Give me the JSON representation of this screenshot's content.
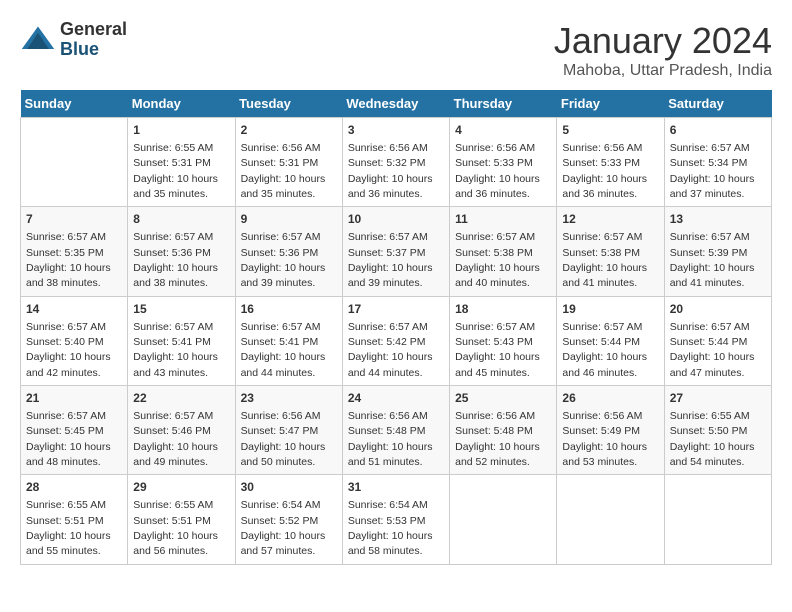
{
  "header": {
    "logo_general": "General",
    "logo_blue": "Blue",
    "month_title": "January 2024",
    "location": "Mahoba, Uttar Pradesh, India"
  },
  "days_of_week": [
    "Sunday",
    "Monday",
    "Tuesday",
    "Wednesday",
    "Thursday",
    "Friday",
    "Saturday"
  ],
  "weeks": [
    [
      {
        "day": "",
        "info": ""
      },
      {
        "day": "1",
        "info": "Sunrise: 6:55 AM\nSunset: 5:31 PM\nDaylight: 10 hours\nand 35 minutes."
      },
      {
        "day": "2",
        "info": "Sunrise: 6:56 AM\nSunset: 5:31 PM\nDaylight: 10 hours\nand 35 minutes."
      },
      {
        "day": "3",
        "info": "Sunrise: 6:56 AM\nSunset: 5:32 PM\nDaylight: 10 hours\nand 36 minutes."
      },
      {
        "day": "4",
        "info": "Sunrise: 6:56 AM\nSunset: 5:33 PM\nDaylight: 10 hours\nand 36 minutes."
      },
      {
        "day": "5",
        "info": "Sunrise: 6:56 AM\nSunset: 5:33 PM\nDaylight: 10 hours\nand 36 minutes."
      },
      {
        "day": "6",
        "info": "Sunrise: 6:57 AM\nSunset: 5:34 PM\nDaylight: 10 hours\nand 37 minutes."
      }
    ],
    [
      {
        "day": "7",
        "info": "Sunrise: 6:57 AM\nSunset: 5:35 PM\nDaylight: 10 hours\nand 38 minutes."
      },
      {
        "day": "8",
        "info": "Sunrise: 6:57 AM\nSunset: 5:36 PM\nDaylight: 10 hours\nand 38 minutes."
      },
      {
        "day": "9",
        "info": "Sunrise: 6:57 AM\nSunset: 5:36 PM\nDaylight: 10 hours\nand 39 minutes."
      },
      {
        "day": "10",
        "info": "Sunrise: 6:57 AM\nSunset: 5:37 PM\nDaylight: 10 hours\nand 39 minutes."
      },
      {
        "day": "11",
        "info": "Sunrise: 6:57 AM\nSunset: 5:38 PM\nDaylight: 10 hours\nand 40 minutes."
      },
      {
        "day": "12",
        "info": "Sunrise: 6:57 AM\nSunset: 5:38 PM\nDaylight: 10 hours\nand 41 minutes."
      },
      {
        "day": "13",
        "info": "Sunrise: 6:57 AM\nSunset: 5:39 PM\nDaylight: 10 hours\nand 41 minutes."
      }
    ],
    [
      {
        "day": "14",
        "info": "Sunrise: 6:57 AM\nSunset: 5:40 PM\nDaylight: 10 hours\nand 42 minutes."
      },
      {
        "day": "15",
        "info": "Sunrise: 6:57 AM\nSunset: 5:41 PM\nDaylight: 10 hours\nand 43 minutes."
      },
      {
        "day": "16",
        "info": "Sunrise: 6:57 AM\nSunset: 5:41 PM\nDaylight: 10 hours\nand 44 minutes."
      },
      {
        "day": "17",
        "info": "Sunrise: 6:57 AM\nSunset: 5:42 PM\nDaylight: 10 hours\nand 44 minutes."
      },
      {
        "day": "18",
        "info": "Sunrise: 6:57 AM\nSunset: 5:43 PM\nDaylight: 10 hours\nand 45 minutes."
      },
      {
        "day": "19",
        "info": "Sunrise: 6:57 AM\nSunset: 5:44 PM\nDaylight: 10 hours\nand 46 minutes."
      },
      {
        "day": "20",
        "info": "Sunrise: 6:57 AM\nSunset: 5:44 PM\nDaylight: 10 hours\nand 47 minutes."
      }
    ],
    [
      {
        "day": "21",
        "info": "Sunrise: 6:57 AM\nSunset: 5:45 PM\nDaylight: 10 hours\nand 48 minutes."
      },
      {
        "day": "22",
        "info": "Sunrise: 6:57 AM\nSunset: 5:46 PM\nDaylight: 10 hours\nand 49 minutes."
      },
      {
        "day": "23",
        "info": "Sunrise: 6:56 AM\nSunset: 5:47 PM\nDaylight: 10 hours\nand 50 minutes."
      },
      {
        "day": "24",
        "info": "Sunrise: 6:56 AM\nSunset: 5:48 PM\nDaylight: 10 hours\nand 51 minutes."
      },
      {
        "day": "25",
        "info": "Sunrise: 6:56 AM\nSunset: 5:48 PM\nDaylight: 10 hours\nand 52 minutes."
      },
      {
        "day": "26",
        "info": "Sunrise: 6:56 AM\nSunset: 5:49 PM\nDaylight: 10 hours\nand 53 minutes."
      },
      {
        "day": "27",
        "info": "Sunrise: 6:55 AM\nSunset: 5:50 PM\nDaylight: 10 hours\nand 54 minutes."
      }
    ],
    [
      {
        "day": "28",
        "info": "Sunrise: 6:55 AM\nSunset: 5:51 PM\nDaylight: 10 hours\nand 55 minutes."
      },
      {
        "day": "29",
        "info": "Sunrise: 6:55 AM\nSunset: 5:51 PM\nDaylight: 10 hours\nand 56 minutes."
      },
      {
        "day": "30",
        "info": "Sunrise: 6:54 AM\nSunset: 5:52 PM\nDaylight: 10 hours\nand 57 minutes."
      },
      {
        "day": "31",
        "info": "Sunrise: 6:54 AM\nSunset: 5:53 PM\nDaylight: 10 hours\nand 58 minutes."
      },
      {
        "day": "",
        "info": ""
      },
      {
        "day": "",
        "info": ""
      },
      {
        "day": "",
        "info": ""
      }
    ]
  ]
}
